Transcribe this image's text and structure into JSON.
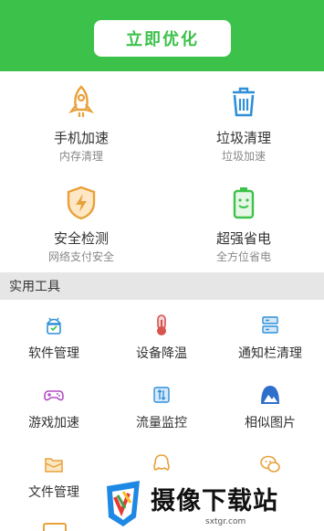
{
  "header": {
    "button_label": "立即优化",
    "accent_color": "#3cc24a"
  },
  "main_features": [
    {
      "title": "手机加速",
      "subtitle": "内存清理",
      "icon": "rocket-icon"
    },
    {
      "title": "垃圾清理",
      "subtitle": "垃圾加速",
      "icon": "trash-icon"
    },
    {
      "title": "安全检测",
      "subtitle": "网络支付安全",
      "icon": "shield-icon"
    },
    {
      "title": "超强省电",
      "subtitle": "全方位省电",
      "icon": "battery-icon"
    }
  ],
  "tools_section": {
    "title": "实用工具",
    "items": [
      {
        "label": "软件管理",
        "icon": "android-icon"
      },
      {
        "label": "设备降温",
        "icon": "thermometer-icon"
      },
      {
        "label": "通知栏清理",
        "icon": "notification-icon"
      },
      {
        "label": "游戏加速",
        "icon": "gamepad-icon"
      },
      {
        "label": "流量监控",
        "icon": "traffic-icon"
      },
      {
        "label": "相似图片",
        "icon": "image-icon"
      },
      {
        "label": "文件管理",
        "icon": "folder-icon"
      },
      {
        "label": "",
        "icon": "qq-icon"
      },
      {
        "label": "",
        "icon": "wechat-icon"
      }
    ]
  },
  "watermark": {
    "text": "摄像下载站",
    "url": "sxtgr.com"
  }
}
